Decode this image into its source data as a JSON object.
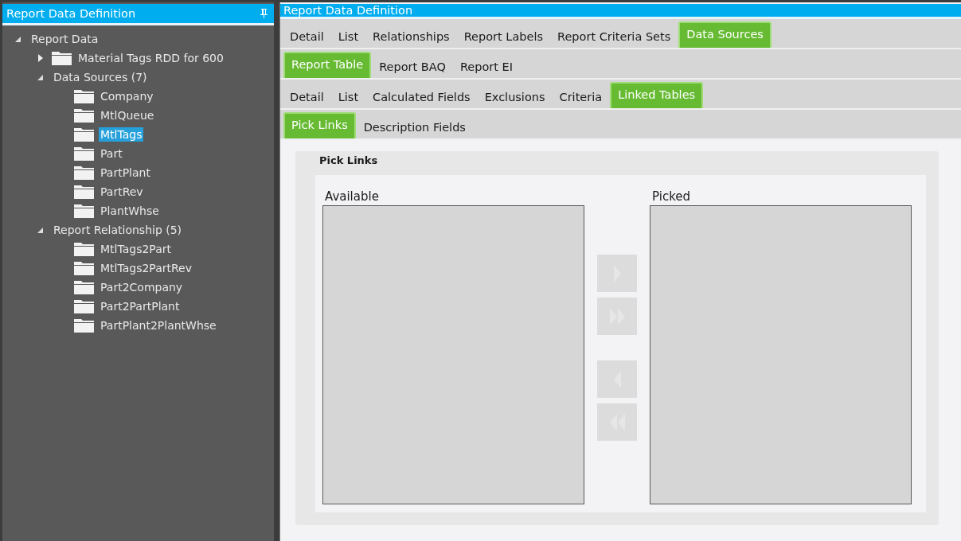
{
  "tree_panel": {
    "title": "Report Data Definition",
    "pinned": true,
    "tree": [
      {
        "label": "Report Data",
        "kind": "group",
        "expanded": true,
        "selected": false,
        "children": [
          {
            "label": "Material Tags RDD for 600",
            "kind": "folder",
            "expanded": false,
            "selected": false
          },
          {
            "label": "Data Sources (7)",
            "kind": "group",
            "expanded": true,
            "selected": false,
            "children": [
              {
                "label": "Company",
                "kind": "folder",
                "selected": false
              },
              {
                "label": "MtlQueue",
                "kind": "folder",
                "selected": false
              },
              {
                "label": "MtlTags",
                "kind": "folder",
                "selected": true
              },
              {
                "label": "Part",
                "kind": "folder",
                "selected": false
              },
              {
                "label": "PartPlant",
                "kind": "folder",
                "selected": false
              },
              {
                "label": "PartRev",
                "kind": "folder",
                "selected": false
              },
              {
                "label": "PlantWhse",
                "kind": "folder",
                "selected": false
              }
            ]
          },
          {
            "label": "Report Relationship (5)",
            "kind": "group",
            "expanded": true,
            "selected": false,
            "children": [
              {
                "label": "MtlTags2Part",
                "kind": "folder",
                "selected": false
              },
              {
                "label": "MtlTags2PartRev",
                "kind": "folder",
                "selected": false
              },
              {
                "label": "Part2Company",
                "kind": "folder",
                "selected": false
              },
              {
                "label": "Part2PartPlant",
                "kind": "folder",
                "selected": false
              },
              {
                "label": "PartPlant2PlantWhse",
                "kind": "folder",
                "selected": false
              }
            ]
          }
        ]
      }
    ]
  },
  "main_panel": {
    "title": "Report Data Definition",
    "tab_rows": [
      [
        {
          "label": "Detail",
          "selected": false
        },
        {
          "label": "List",
          "selected": false
        },
        {
          "label": "Relationships",
          "selected": false
        },
        {
          "label": "Report Labels",
          "selected": false
        },
        {
          "label": "Report Criteria Sets",
          "selected": false
        },
        {
          "label": "Data Sources",
          "selected": true
        }
      ],
      [
        {
          "label": "Report Table",
          "selected": true
        },
        {
          "label": "Report BAQ",
          "selected": false
        },
        {
          "label": "Report EI",
          "selected": false
        }
      ],
      [
        {
          "label": "Detail",
          "selected": false
        },
        {
          "label": "List",
          "selected": false
        },
        {
          "label": "Calculated Fields",
          "selected": false
        },
        {
          "label": "Exclusions",
          "selected": false
        },
        {
          "label": "Criteria",
          "selected": false
        },
        {
          "label": "Linked Tables",
          "selected": true
        }
      ],
      [
        {
          "label": "Pick Links",
          "selected": true
        },
        {
          "label": "Description Fields",
          "selected": false
        }
      ]
    ],
    "group": {
      "title": "Pick Links",
      "available_label": "Available",
      "picked_label": "Picked",
      "move_buttons": [
        {
          "kind": "add",
          "disabled": true
        },
        {
          "kind": "add-all",
          "disabled": true
        },
        {
          "kind": "remove",
          "disabled": true
        },
        {
          "kind": "remove-all",
          "disabled": true
        }
      ]
    }
  }
}
